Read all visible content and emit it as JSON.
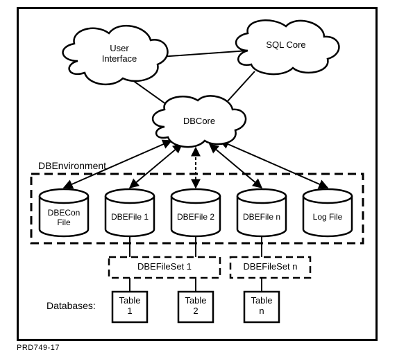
{
  "clouds": {
    "user_interface": "User\nInterface",
    "sql_core": "SQL Core",
    "dbcore": "DBCore"
  },
  "env_label": "DBEnvironment",
  "cylinders": {
    "dbecon": "DBECon\nFile",
    "dbefile1": "DBEFile 1",
    "dbefile2": "DBEFile 2",
    "dbefilen": "DBEFile n",
    "logfile": "Log File"
  },
  "filesets": {
    "set1": "DBEFileSet 1",
    "setn": "DBEFileSet n"
  },
  "databases_label": "Databases:",
  "tables": {
    "t1": "Table\n1",
    "t2": "Table\n2",
    "tn": "Table\nn"
  },
  "reference": "PRD749-17"
}
